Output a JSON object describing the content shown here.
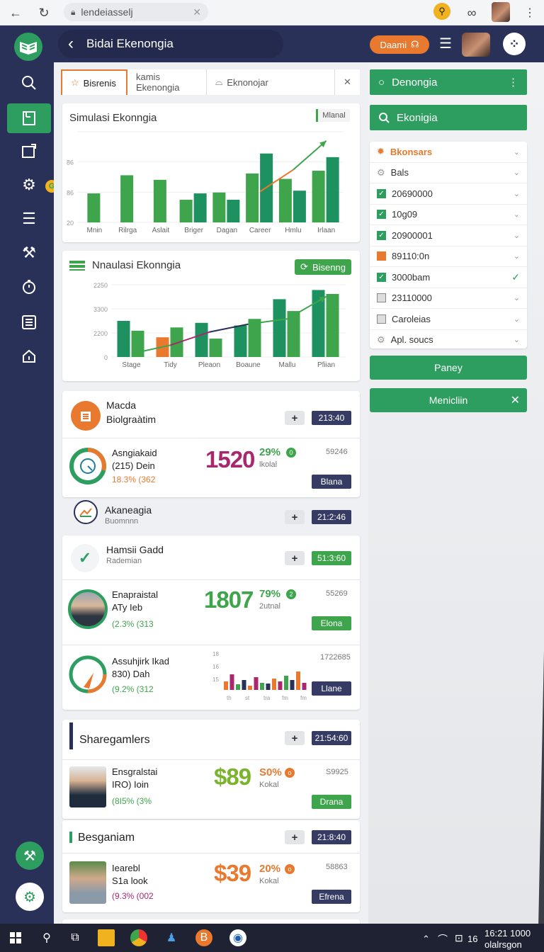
{
  "browser": {
    "url": "lendeiasselj",
    "close": "✕"
  },
  "header": {
    "back": "‹",
    "title": "Bidai Ekenongia",
    "demo": "Daami",
    "demo_icon": "☊"
  },
  "sidebar": {
    "items": [
      "search-icon",
      "document-icon",
      "window-icon",
      "gear-icon",
      "list-icon",
      "wand-icon",
      "timer-icon",
      "checklist-icon",
      "house-icon"
    ],
    "badge": "G"
  },
  "tabs": [
    {
      "label": "Bisrenis"
    },
    {
      "label": "kamis Ekenongia"
    },
    {
      "label": "Eknonojar"
    }
  ],
  "chart1": {
    "title": "Simulasi Ekonngia",
    "badge": "Mlanal"
  },
  "chart2": {
    "title": "Nnaulasi Ekonngia",
    "button": "Bisenng"
  },
  "chart_data": [
    {
      "type": "bar",
      "title": "Simulasi Ekonngia",
      "categories": [
        "Mnin",
        "Rilrga",
        "Aslait",
        "Briger",
        "Dagan",
        "Career",
        "Hmlu",
        "Irlaan"
      ],
      "ylabel": "",
      "yticks": [
        "",
        "86",
        "86",
        "20"
      ],
      "series": [
        {
          "values": [
            32,
            52,
            47,
            25,
            33,
            54,
            48,
            57
          ],
          "color": "#3ea54c"
        },
        {
          "values": [
            0,
            0,
            0,
            32,
            25,
            76,
            35,
            72
          ],
          "color": "#1e9160"
        }
      ],
      "line": [
        null,
        null,
        null,
        null,
        null,
        34,
        58,
        90
      ],
      "ylim": [
        0,
        100
      ]
    },
    {
      "type": "bar",
      "title": "Nnaulasi Ekonngia",
      "categories": [
        "Stage",
        "Tidy",
        "Pleaon",
        "Boaune",
        "Mallu",
        "Pfiian"
      ],
      "yticks": [
        "2250",
        "3300",
        "2200",
        "0"
      ],
      "series": [
        {
          "values": [
            55,
            30,
            52,
            48,
            88,
            102
          ],
          "color": "#1e9160"
        },
        {
          "values": [
            40,
            45,
            28,
            58,
            70,
            96
          ],
          "color": "#3ea54c"
        }
      ],
      "line": [
        5,
        18,
        38,
        50,
        58,
        92
      ],
      "ylim": [
        0,
        110
      ]
    }
  ],
  "sections": [
    {
      "icon": "bank-icon",
      "title": "Macda",
      "subtitle": "Biolgraàtim",
      "tag": "213:40",
      "stat": {
        "l1": "Asngiakaid",
        "l2": "(215) Dein",
        "l3": "18.3% (362",
        "big": "1520",
        "pct": "29%",
        "sub": "lkolal",
        "num": "59246",
        "btn": "Blana"
      }
    },
    {
      "icon": "trend-icon",
      "title": "Akaneagia",
      "subtitle": "Buomnnn",
      "tag": "21:2:46"
    },
    {
      "icon": "check-icon",
      "title": "Hamsii Gadd",
      "subtitle": "Rademian",
      "tag": "51:3:60",
      "stat": {
        "l1": "Enapraistal",
        "l2": "ATy Ieb",
        "l3": "(2.3% (313",
        "big": "1807",
        "pct": "79%",
        "sub": "2utnal",
        "num": "55269",
        "btn": "Elona"
      },
      "stat2": {
        "l1": "Assuhjirk Ikad",
        "l2": "830) Dah",
        "l3": "(9.2% (312",
        "num": "1722685",
        "btn": "Llane",
        "xticks": [
          "th",
          "st",
          "tra",
          "fm",
          "fm"
        ],
        "yticks": [
          "18",
          "16",
          "15"
        ]
      }
    },
    {
      "title": "Sharegamlers",
      "tag": "21:54:60",
      "stat": {
        "l1": "Ensgralstai",
        "l2": "IRO) Ioin",
        "l3": "(8I5% (3%",
        "big": "$89",
        "pct": "S0%",
        "sub": "Kokal",
        "num": "S9925",
        "btn": "Drana"
      }
    },
    {
      "title": "Besganiam",
      "tag": "21:8:40",
      "stat": {
        "l1": "Iearebl",
        "l2": "S1a look",
        "l3": "(9.3% (002",
        "big": "$39",
        "pct": "20%",
        "sub": "Kokal",
        "num": "58863",
        "btn": "Efrena"
      }
    }
  ],
  "right": {
    "search1": "Denongia",
    "search2": "Ekonigia",
    "list": [
      {
        "label": "Bkonsars",
        "state": "header"
      },
      {
        "label": "Bals",
        "state": "none"
      },
      {
        "label": "20690000",
        "state": "checked"
      },
      {
        "label": "10g09",
        "state": "checked"
      },
      {
        "label": "20900001",
        "state": "checked"
      },
      {
        "label": "89110:0n",
        "state": "orange"
      },
      {
        "label": "3000bam",
        "state": "checked"
      },
      {
        "label": "23110000",
        "state": "gray"
      },
      {
        "label": "Caroleias",
        "state": "gray"
      },
      {
        "label": "Apl. soucs",
        "state": "none"
      }
    ],
    "btn1": "Paney",
    "btn2": "Menicliin"
  },
  "taskbar": {
    "time": "16:21 1000",
    "date": "olalrsgon",
    "lang": "16"
  },
  "colors": {
    "green": "#2e9e60",
    "navy": "#2a3158",
    "orange": "#e8792e",
    "magenta": "#a8286e"
  }
}
